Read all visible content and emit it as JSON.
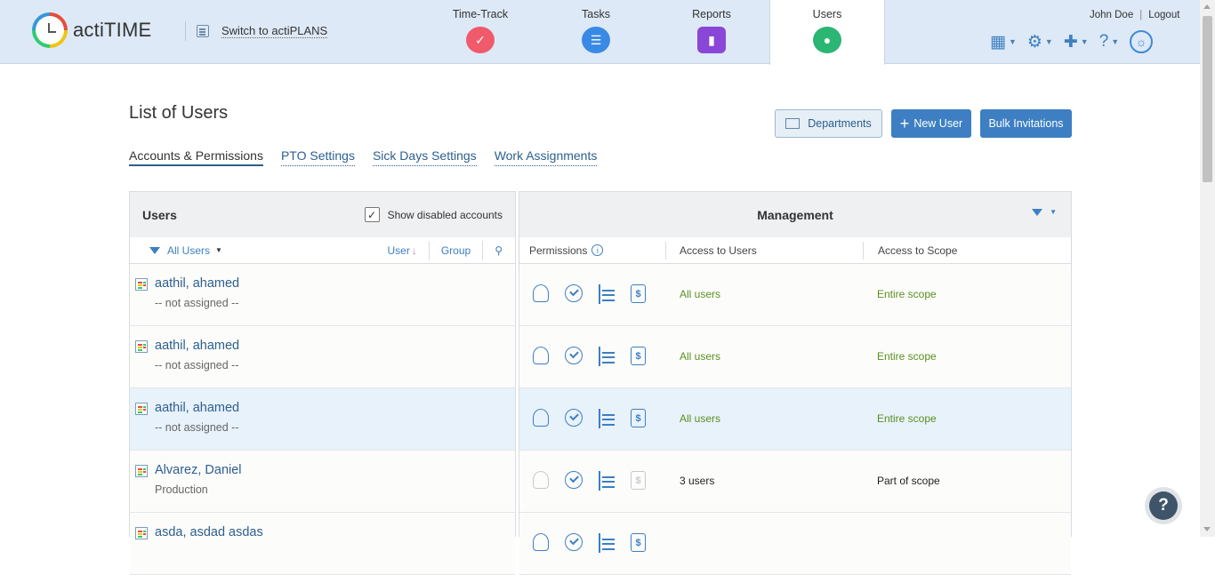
{
  "app": {
    "logo_text": "actiTIME",
    "switch_label": "Switch to actiPLANS"
  },
  "nav": [
    {
      "label": "Time-Track"
    },
    {
      "label": "Tasks"
    },
    {
      "label": "Reports"
    },
    {
      "label": "Users"
    }
  ],
  "header": {
    "user_name": "John Doe",
    "logout": "Logout"
  },
  "page": {
    "title": "List of Users"
  },
  "tabs": [
    {
      "label": "Accounts & Permissions"
    },
    {
      "label": "PTO Settings"
    },
    {
      "label": "Sick Days Settings"
    },
    {
      "label": "Work Assignments"
    }
  ],
  "buttons": {
    "departments": "Departments",
    "new_user": "New User",
    "bulk": "Bulk Invitations"
  },
  "users_panel": {
    "title": "Users",
    "show_disabled": "Show disabled accounts",
    "filter": "All Users",
    "sort_user": "User",
    "sort_group": "Group"
  },
  "management_panel": {
    "title": "Management",
    "col_permissions": "Permissions",
    "col_access_users": "Access to Users",
    "col_access_scope": "Access to Scope"
  },
  "rows": [
    {
      "name": "aathil, ahamed",
      "dept": "-- not assigned --",
      "access_users": "All users",
      "access_scope": "Entire scope"
    },
    {
      "name": "aathil, ahamed",
      "dept": "-- not assigned --",
      "access_users": "All users",
      "access_scope": "Entire scope"
    },
    {
      "name": "aathil, ahamed",
      "dept": "-- not assigned --",
      "access_users": "All users",
      "access_scope": "Entire scope"
    },
    {
      "name": "Alvarez, Daniel",
      "dept": "Production",
      "access_users": "3 users",
      "access_scope": "Part of scope"
    },
    {
      "name": "asda, asdad asdas",
      "dept": "",
      "access_users": "",
      "access_scope": ""
    }
  ],
  "colors": {
    "accent": "#3d7fc2",
    "topbar": "#dde9f6",
    "green_text": "#5a8f1f"
  }
}
